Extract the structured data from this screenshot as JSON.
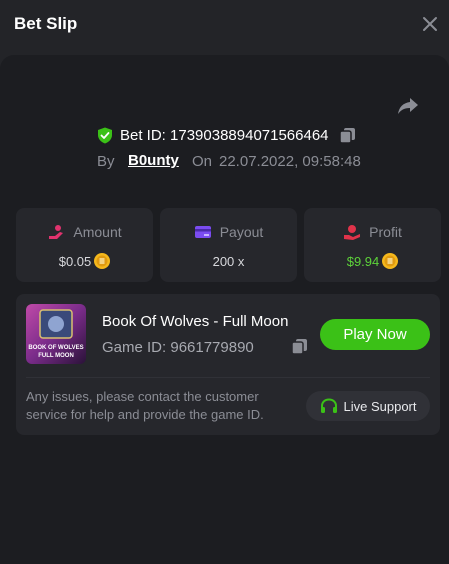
{
  "header": {
    "title": "Bet Slip"
  },
  "bet": {
    "id_label": "Bet ID: 1739038894071566464",
    "by_label": "By",
    "user": "B0unty",
    "on_label": "On",
    "date": "22.07.2022, 09:58:48"
  },
  "stats": {
    "amount": {
      "label": "Amount",
      "value": "$0.05"
    },
    "payout": {
      "label": "Payout",
      "value": "200 x"
    },
    "profit": {
      "label": "Profit",
      "value": "$9.94"
    }
  },
  "game": {
    "title": "Book Of Wolves - Full Moon",
    "id_label": "Game ID: 9661779890",
    "thumb_text_1": "BOOK OF WOLVES",
    "thumb_text_2": "FULL MOON",
    "play_label": "Play Now"
  },
  "support": {
    "issues_text": "Any issues, please contact the customer service for help and provide the game ID.",
    "button_label": "Live Support"
  },
  "colors": {
    "accent_green": "#3bc117",
    "profit_green": "#5dd33a",
    "payout_purple": "#7b4cf0",
    "amount_pink": "#e0336e",
    "profit_red": "#e0334a",
    "coin_gold": "#f5b81c",
    "shield_green": "#3bc117"
  },
  "icons": [
    "close-icon",
    "share-icon",
    "shield-check-icon",
    "copy-icon",
    "amount-icon",
    "payout-card-icon",
    "profit-hand-icon",
    "coin-icon",
    "headset-icon"
  ]
}
